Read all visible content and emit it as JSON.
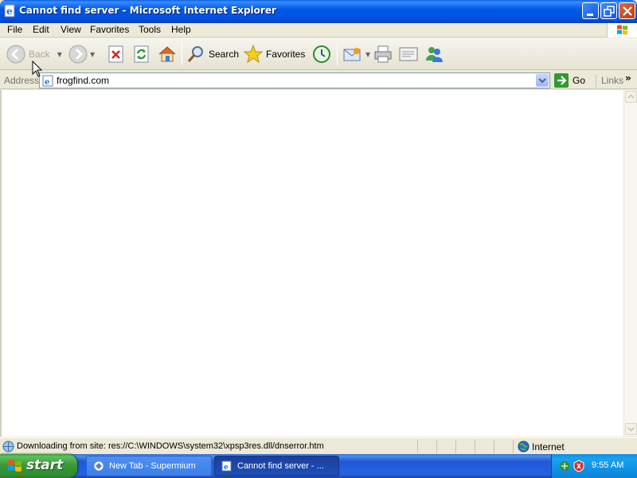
{
  "window": {
    "title": "Cannot find server - Microsoft Internet Explorer"
  },
  "menu": [
    "File",
    "Edit",
    "View",
    "Favorites",
    "Tools",
    "Help"
  ],
  "toolbar": {
    "back_label": "Back",
    "search_label": "Search",
    "favorites_label": "Favorites"
  },
  "address": {
    "label": "Address",
    "value": "frogfind.com",
    "go_label": "Go",
    "links_label": "Links"
  },
  "status": {
    "text": "Downloading from site: res://C:\\WINDOWS\\system32\\xpsp3res.dll/dnserror.htm",
    "zone": "Internet"
  },
  "taskbar": {
    "start_label": "start",
    "tasks": [
      {
        "label": "New Tab - Supermium"
      },
      {
        "label": "Cannot find server - ..."
      }
    ],
    "clock": "9:55 AM"
  },
  "icons": {
    "back": "back-arrow-icon",
    "forward": "forward-arrow-icon",
    "stop": "stop-icon",
    "refresh": "refresh-icon",
    "home": "home-icon",
    "search": "search-icon",
    "favorites": "favorites-star-icon",
    "history": "history-icon",
    "mail": "mail-icon",
    "print": "print-icon",
    "edit": "edit-icon",
    "messenger": "messenger-icon"
  },
  "colors": {
    "titlebar": "#0058e6",
    "start": "#3a9a3a",
    "taskbar": "#2663e0"
  }
}
